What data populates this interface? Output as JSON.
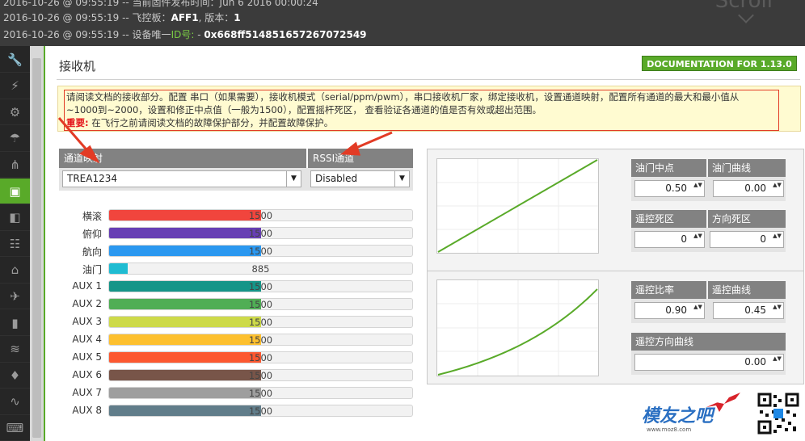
{
  "log": {
    "line1": "2016-10-26 @ 09:55:19 -- 当前固件发布时间：Jun 6 2016 00:00:24",
    "line2_prefix": "2016-10-26 @ 09:55:19 -- 飞控板：",
    "line2_board": "AFF1",
    "line2_mid": ", 版本：",
    "line2_version": "1",
    "line3_prefix": "2016-10-26 @ 09:55:19 -- 设备唯一",
    "line3_id_label": "ID号:",
    "line3_dash": " - ",
    "line3_id": "0x668ff514851657267072549",
    "scroll_text": "Scroll"
  },
  "sidebar": {
    "items": [
      {
        "icon": "wrench-icon",
        "glyph": "🔧"
      },
      {
        "icon": "plug-icon",
        "glyph": "⚡"
      },
      {
        "icon": "gear-icon",
        "glyph": "⚙"
      },
      {
        "icon": "parachute-icon",
        "glyph": "☂"
      },
      {
        "icon": "network-icon",
        "glyph": "⋔"
      },
      {
        "icon": "receiver-icon",
        "glyph": "▣"
      },
      {
        "icon": "toggle-icon",
        "glyph": "◧"
      },
      {
        "icon": "sliders-icon",
        "glyph": "☷"
      },
      {
        "icon": "servo-icon",
        "glyph": "⌂"
      },
      {
        "icon": "satellite-icon",
        "glyph": "✈"
      },
      {
        "icon": "battery-icon",
        "glyph": "▮"
      },
      {
        "icon": "signal-icon",
        "glyph": "≋"
      },
      {
        "icon": "led-icon",
        "glyph": "♦"
      },
      {
        "icon": "pulse-icon",
        "glyph": "∿"
      },
      {
        "icon": "cli-icon",
        "glyph": "⌨"
      }
    ]
  },
  "main": {
    "title": "接收机",
    "doc_button": "DOCUMENTATION FOR 1.13.0",
    "note_line1": "请阅读文档的接收部分。配置 串口（如果需要），接收机模式（serial/ppm/pwm），串口接收机厂家，绑定接收机，设置通道映射，配置所有通道的最大和最小值从",
    "note_line2": "~1000到~2000，设置和修正中点值（一般为1500），配置摇杆死区， 查看验证各通道的值是否有效或超出范围。",
    "note_warn": "重要:",
    "note_line3": " 在飞行之前请阅读文档的故障保护部分，并配置故障保护。"
  },
  "channel_map": {
    "header": "通道映射",
    "value": "TREA1234",
    "rssi_header": "RSSI通道",
    "rssi_value": "Disabled",
    "arrow_glyph": "▼"
  },
  "channels": [
    {
      "label": "横滚",
      "value": "1500",
      "level": 0.5,
      "color": "#f1453d"
    },
    {
      "label": "俯仰",
      "value": "1500",
      "level": 0.5,
      "color": "#673fb4"
    },
    {
      "label": "航向",
      "value": "1500",
      "level": 0.5,
      "color": "#2b98f0"
    },
    {
      "label": "油门",
      "value": "885",
      "level": 0.06,
      "color": "#1fbcd2"
    },
    {
      "label": "AUX 1",
      "value": "1500",
      "level": 0.5,
      "color": "#159588"
    },
    {
      "label": "AUX 2",
      "value": "1500",
      "level": 0.5,
      "color": "#50ae55"
    },
    {
      "label": "AUX 3",
      "value": "1500",
      "level": 0.5,
      "color": "#cdda49"
    },
    {
      "label": "AUX 4",
      "value": "1500",
      "level": 0.5,
      "color": "#fdc02f"
    },
    {
      "label": "AUX 5",
      "value": "1500",
      "level": 0.5,
      "color": "#fc5830"
    },
    {
      "label": "AUX 6",
      "value": "1500",
      "level": 0.5,
      "color": "#785549"
    },
    {
      "label": "AUX 7",
      "value": "1500",
      "level": 0.5,
      "color": "#9e9e9e"
    },
    {
      "label": "AUX 8",
      "value": "1500",
      "level": 0.5,
      "color": "#617d8a"
    }
  ],
  "throttle": {
    "mid_label": "油门中点",
    "mid_value": "0.50",
    "expo_label": "油门曲线",
    "expo_value": "0.00",
    "rc_deadband_label": "遥控死区",
    "rc_deadband_value": "0",
    "yaw_deadband_label": "方向死区",
    "yaw_deadband_value": "0"
  },
  "rates": {
    "rc_rate_label": "遥控比率",
    "rc_rate_value": "0.90",
    "rc_expo_label": "遥控曲线",
    "rc_expo_value": "0.45",
    "yaw_expo_label": "遥控方向曲线",
    "yaw_expo_value": "0.00"
  },
  "spin_glyph": "▲▼",
  "watermark": {
    "brand": "模友之吧",
    "url": "www.moz8.com"
  },
  "colors": {
    "accent": "#59aa29",
    "annotation": "#e23b25"
  }
}
